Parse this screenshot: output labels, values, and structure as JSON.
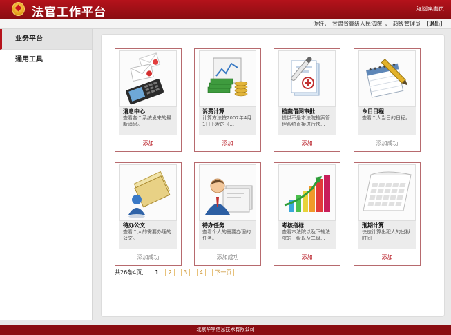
{
  "header": {
    "title": "法官工作平台",
    "back_link": "返回桌面页"
  },
  "userbar": {
    "greeting": "你好，",
    "court": "甘肃省高级人民法院",
    "separator": "，",
    "role": "超级管理员",
    "logout": "【退出】"
  },
  "sidebar": {
    "items": [
      {
        "label": "业务平台"
      },
      {
        "label": "通用工具"
      }
    ]
  },
  "cards": [
    {
      "title": "消息中心",
      "desc": "查看各个系统发来的最新消息。",
      "action": "添加",
      "icon": "envelopes-phone-icon"
    },
    {
      "title": "诉费计算",
      "desc": "计算方法按2007年4月1日下发的《...",
      "action": "添加",
      "icon": "money-calculator-icon"
    },
    {
      "title": "档案借阅审批",
      "desc": "提供不是本法院档案管理系统直接进行快...",
      "action": "添加",
      "icon": "medical-records-icon"
    },
    {
      "title": "今日日程",
      "desc": "查看个人当日的日程。",
      "action": "添加成功",
      "icon": "calendar-pen-icon"
    },
    {
      "title": "待办公文",
      "desc": "查看个人的需要办理的公文。",
      "action": "添加成功",
      "icon": "folders-user-icon"
    },
    {
      "title": "待办任务",
      "desc": "查看个人的需要办理的任务。",
      "action": "添加成功",
      "icon": "user-documents-icon"
    },
    {
      "title": "考核指标",
      "desc": "查看本法院以及下辖法院的一级以及二级...",
      "action": "添加",
      "icon": "bar-chart-arrow-icon"
    },
    {
      "title": "刑期计算",
      "desc": "快速计算出犯人的出狱时间",
      "action": "添加",
      "icon": "calendar-page-icon"
    }
  ],
  "pager": {
    "summary": "共26条4页,",
    "current": "1",
    "pages": [
      "2",
      "3",
      "4"
    ],
    "next": "下一页"
  },
  "footer": {
    "text": "北京华宇信息技术有限公司"
  },
  "colors": {
    "brand_red": "#b5121b",
    "card_border": "#b76a6e",
    "pager_gold": "#c68a1e"
  }
}
